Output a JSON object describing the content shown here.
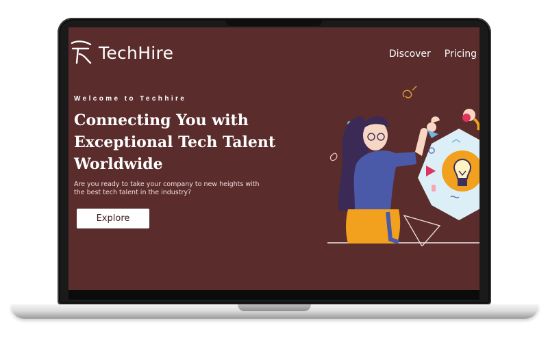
{
  "site": {
    "brand": "TechHire",
    "nav": [
      {
        "label": "Discover"
      },
      {
        "label": "Pricing"
      }
    ]
  },
  "hero": {
    "eyebrow": "Welcome to Techhire",
    "headline_lines": [
      "Connecting You with",
      "Exceptional Tech Talent",
      "Worldwide"
    ],
    "subtext": "Are you ready to take your company to new heights with the best tech talent in the industry?",
    "cta_label": "Explore"
  },
  "colors": {
    "background": "#5b2c2c",
    "accent_yellow": "#f2a11f",
    "illustration_blue": "#4a5aa8",
    "hex_panel": "#dceef6"
  },
  "icons": [
    "logo-mark-icon",
    "lightbulb-icon",
    "play-icon"
  ]
}
